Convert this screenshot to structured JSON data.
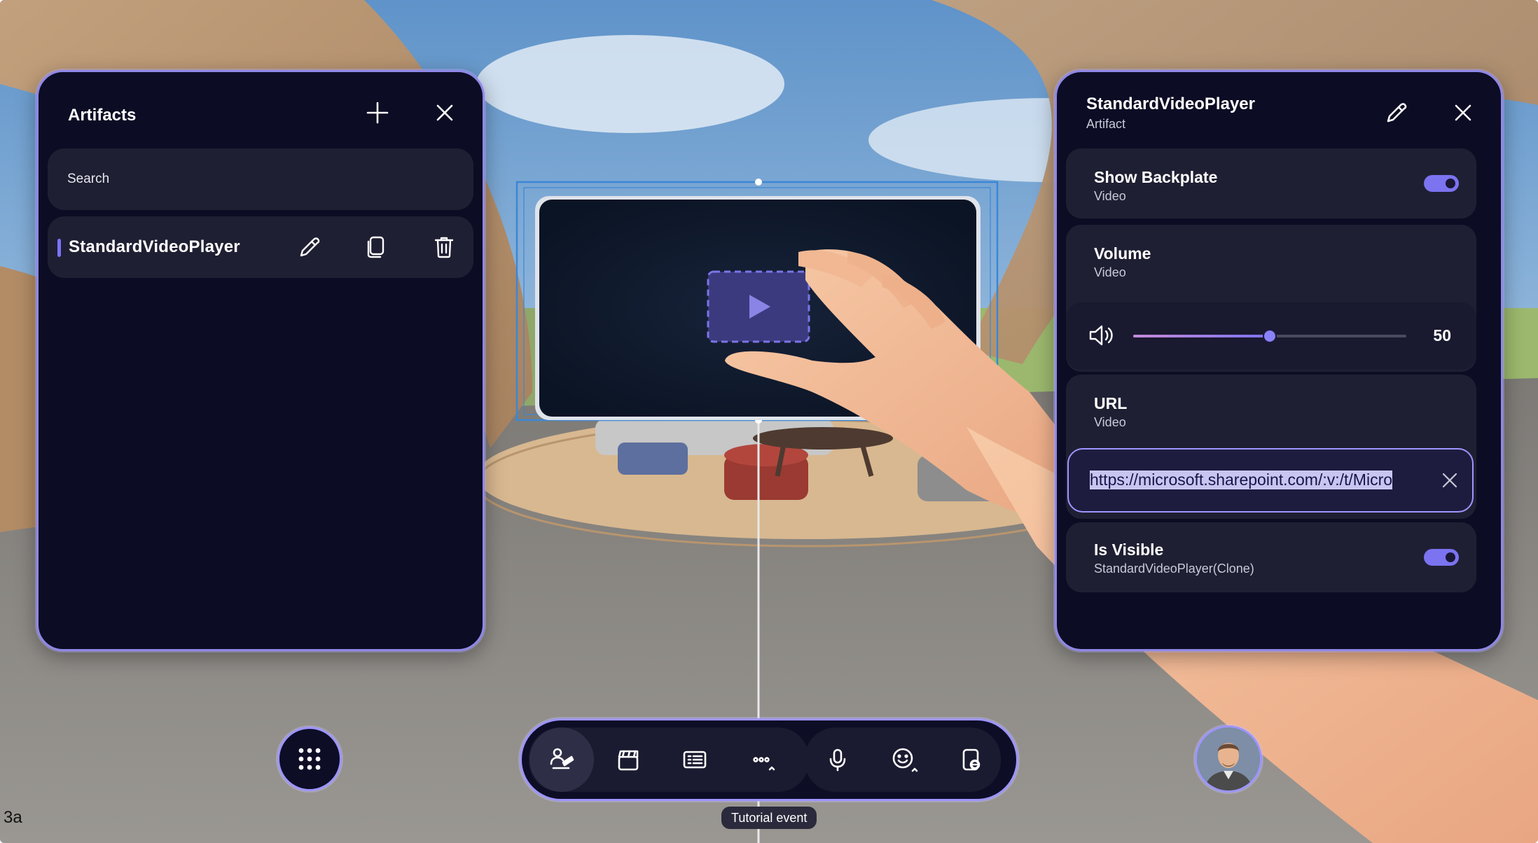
{
  "artifacts_panel": {
    "title": "Artifacts",
    "search_placeholder": "Search",
    "items": [
      {
        "label": "StandardVideoPlayer"
      }
    ]
  },
  "properties_panel": {
    "title": "StandardVideoPlayer",
    "subtitle": "Artifact",
    "show_backplate": {
      "label": "Show Backplate",
      "sub": "Video",
      "enabled": true
    },
    "volume": {
      "label": "Volume",
      "sub": "Video",
      "value": "50",
      "value_fraction": 0.5
    },
    "url": {
      "label": "URL",
      "sub": "Video",
      "value": "https://microsoft.sharepoint.com/:v:/t/Micro"
    },
    "is_visible": {
      "label": "Is Visible",
      "sub": "StandardVideoPlayer(Clone)",
      "enabled": true
    }
  },
  "toolbar": {
    "buttons": [
      {
        "icon": "people-place-icon",
        "active": true
      },
      {
        "icon": "clapperboard-icon"
      },
      {
        "icon": "media-panel-icon"
      },
      {
        "icon": "more-icon"
      },
      {
        "icon": "microphone-icon"
      },
      {
        "icon": "emoji-icon"
      },
      {
        "icon": "leave-device-icon"
      }
    ],
    "tooltip": "Tutorial event"
  },
  "apps_button": {
    "icon": "grid-dots-icon"
  },
  "corner_label": "3a",
  "colors": {
    "panel_bg": "#0c0c24",
    "panel_border": "#8f88e8",
    "accent": "#7b73f0",
    "card_bg": "#1f1f33"
  }
}
